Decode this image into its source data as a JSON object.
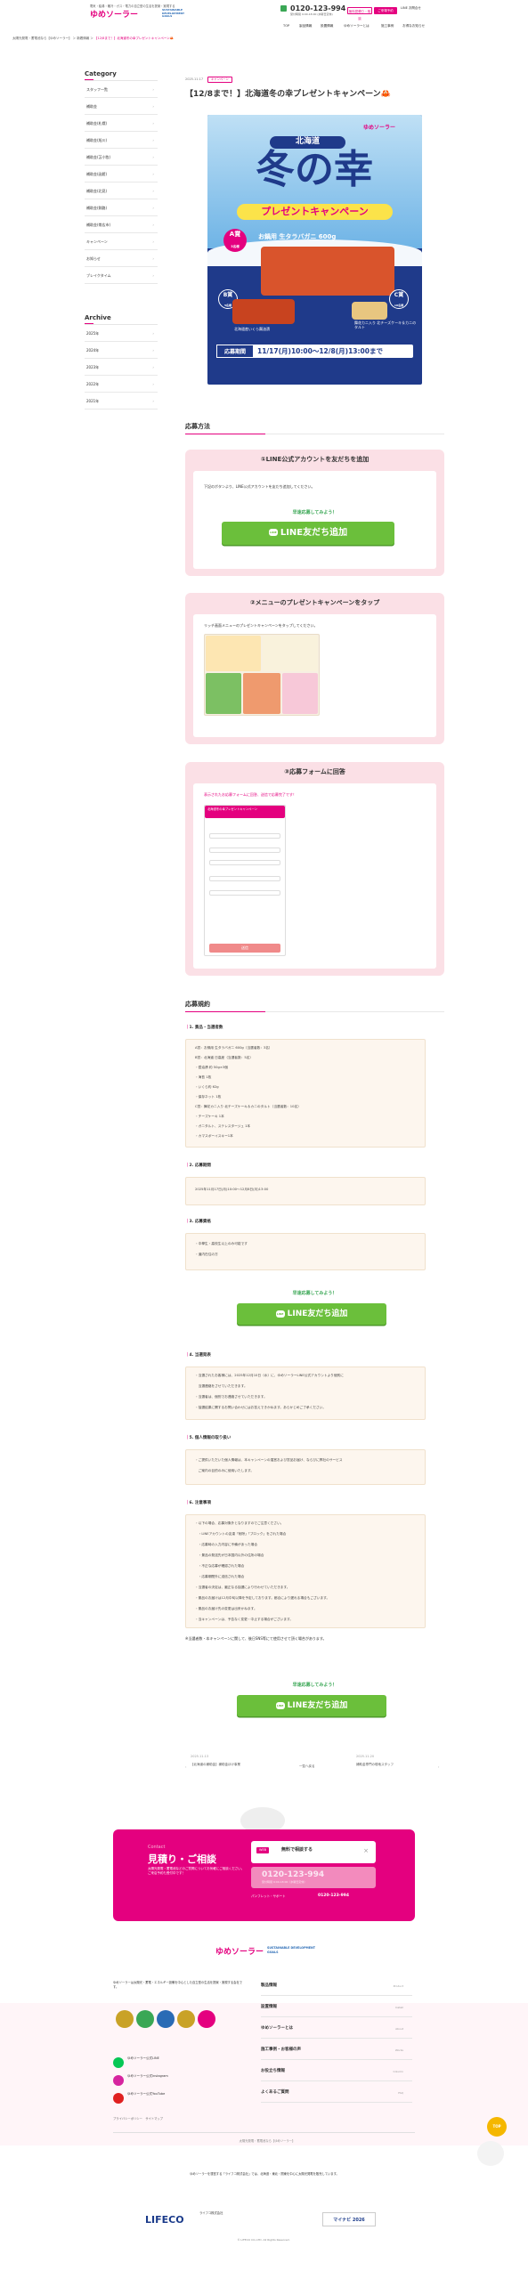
{
  "header": {
    "tagline": "電気・給湯・暖冷・ガス・電力の自立型の生活を提案・実現する",
    "logo": "ゆめソーラー",
    "goals": "SUSTAINABLE DEVELOPMENT GOALS",
    "phone": "0120-123-994",
    "phone_sub": "受付時間 9:00-18:00 (水曜日定休)",
    "btn_estimate": "無料見積り・相談",
    "btn_showroom": "ご来場予約",
    "line_link": "LINE お問合せ",
    "nav": [
      "TOP",
      "製品情報",
      "設置情報",
      "ゆめソーラーとは",
      "施工事例",
      "お得なお知らせ"
    ]
  },
  "breadcrumb": {
    "home": "太陽光発電・蓄電池なら【ゆめソーラー】",
    "section": "新着情報",
    "current": "【12/8まで！】北海道冬の幸プレゼントキャンペーン🦀"
  },
  "sidebar": {
    "category_title": "Category",
    "categories": [
      "スタッフ一覧",
      "補助金",
      "補助金(札幌)",
      "補助金(旭川)",
      "補助金(苫小牧)",
      "補助金(函館)",
      "補助金(北見)",
      "補助金(釧路)",
      "補助金(帯広市)",
      "キャンペーン",
      "お知らせ",
      "ブレイクタイム"
    ],
    "archive_title": "Archive",
    "archives": [
      "2025年",
      "2024年",
      "2023年",
      "2022年",
      "2021年"
    ]
  },
  "post": {
    "date": "2025.11.17",
    "tag": "キャンペーン",
    "title": "【12/8まで！】北海道冬の幸プレゼントキャンペーン🦀",
    "banner": {
      "brand": "ゆめソーラー",
      "region": "北海道",
      "headline": "冬の幸",
      "subtitle": "プレゼントキャンペーン",
      "prize_a_label": "A賞",
      "prize_a_count": "3名様",
      "prize_a": "お鍋用 生タラバガニ 600g",
      "prize_b_label": "B賞",
      "prize_b_count": "5名様",
      "prize_b": "北海道産いくら醤油漬",
      "prize_c_label": "C賞",
      "prize_c_count": "10名様",
      "prize_c": "舞花カニ入り 北チーズケーキ＆カニのタルト",
      "period_label": "応募期間",
      "period": "11/17(月)10:00〜12/8(月)13:00まで"
    }
  },
  "apply": {
    "title": "応募方法",
    "step1_title": "①LINE公式アカウントを友だちを追加",
    "step1_text": "下記のボタンより、LINE公式アカウントを友だち追加してください。",
    "try_label": "早速応募してみよう！",
    "line_btn": "LINE友だち追加",
    "step2_title": "②メニューのプレゼントキャンペーンをタップ",
    "step2_text": "リッチ画面メニューのプレゼントキャンペーンをタップしてください。",
    "step3_title": "③応募フォームに回答",
    "step3_text": "表示されたお応募フォームに回答、送信で応募完了です！",
    "form_head": "北海道冬の幸プレゼントキャンペーン",
    "form_submit": "送信"
  },
  "rules": {
    "title": "応募規約",
    "s1": "1. 景品・当選者数",
    "s1_lines": [
      "A賞：お鍋用 生タラバガニ 600g（当選者数：3名）",
      "B賞：北海道 日高産（当選者数：5名）",
      "・醤油漬 約 50g×3個",
      "・海苔 1枚",
      "・いくら約 62g",
      "・保存ネット 1枚",
      "C賞：舞花カニ入り 北チーズケーキ＆カニのタルト（当選者数：10名）",
      "・チーズケーキ 1本",
      "・ガニタルト、ステレスタージュ 1本",
      "・カマスボーイスキー1本"
    ],
    "s2": "2. 応募期間",
    "s2_lines": [
      "2025年11月17日(月)10:00〜12月8日(月)13:00"
    ],
    "s3": "3. 応募資格",
    "s3_lines": [
      "・中學生・高校生以上のみ可能です",
      "・道内在住の方"
    ],
    "s4": "4. 当選発表",
    "s4_lines": [
      "・当選されたお客様には、2025年12月10日（水）に、ゆめソーラーLINE公式アカウントより個別に",
      "　当選連絡をさせていただきます。",
      "・当選者は、個別でお連絡させていただきます。",
      "・抽選結果に関するお問い合わせにはお答えできかねます。あらかじめご了承ください。"
    ],
    "s5": "5. 個人情報の取り扱い",
    "s5_lines": [
      "・ご提供いただいた個人情報は、本キャンペーンの運営および賞品お届け、ならびに弊社のサービス",
      "　ご案内の目的のみに使用いたします。"
    ],
    "s6": "6. 注意事項",
    "s6_lines": [
      "・以下の場合、応募対象外となりますのでご注意ください。",
      "　・LINEアカウントの友達「削除」「ブロック」をされた場合",
      "　・応募時の入力内容に不備があった場合",
      "　・景品の発送先が日本国内以外の住所の場合",
      "　・不正な応募が確認された場合",
      "　・応募期間外に送信された場合",
      "・当選者の決定は、厳正なる抽選により行わせていただきます。",
      "・景品のお届けは12月中旬以降を予定しております。都合により遅れる場合もございます。",
      "・景品のお届け先の変更は出来かねます。",
      "・当キャンペーンは、予告なく変更・中止する場合がございます。"
    ],
    "footnote": "※当選者数・本キャンペーンに関して、後日SNS等にて使用させて頂く場合があります。",
    "try_label": "早速応募してみよう！",
    "line_btn": "LINE友だち追加"
  },
  "post_nav": {
    "prev_date": "2025.11.13",
    "prev": "【北海道の補助金】補助金ほけ事業",
    "back": "一覧へ戻る",
    "next_date": "2025.11.20",
    "next": "補助金専門の現地スタッフ"
  },
  "contact": {
    "en": "Contact",
    "title": "見積り・ご相談",
    "desc": "太陽光発電・蓄電池などのご質問についてお気軽にご相談ください。ご来店予約も受付中です！",
    "web_badge": "WEB",
    "web": "無料で相談する",
    "close": "×",
    "tel": "0120-123-994",
    "tel_sub": "受付時間 9:00-18:00（水曜日定休）",
    "bottom": "パンフレット・サポート",
    "phone_small": "0120-123-994"
  },
  "footer": {
    "goals": "SUSTAINABLE DEVELOPMENT GOALS",
    "company_text": "ゆめソーラーは太陽光・蓄電・エネルギー設備を中心とした自立型の生活を提案・実現する会社です。",
    "sns": [
      "ゆめソーラー公式LINE",
      "ゆめソーラー公式Instagram",
      "ゆめソーラー公式YouTube"
    ],
    "nav": [
      "製品情報",
      "設置情報",
      "ゆめソーラーとは",
      "施工事例・お客様の声",
      "お役立ち情報",
      "よくあるご質問"
    ],
    "nav_en": [
      "Product",
      "Install",
      "About",
      "Works",
      "Column",
      "FAQ"
    ],
    "bottom_links": "プライバシーポリシー　サイトマップ",
    "note": "ゆめソーラーを運営する「ライフコ株式会社」では、北海道・東北・関東を中心に太陽光発電を販売しています。",
    "company": "ライフコ株式会社",
    "lifeco": "LIFECO",
    "copyright": "© LIFECO CO.,LTD. All Rights Reserved.",
    "mynavi": "マイナビ 2026",
    "to_top": "TOP"
  }
}
